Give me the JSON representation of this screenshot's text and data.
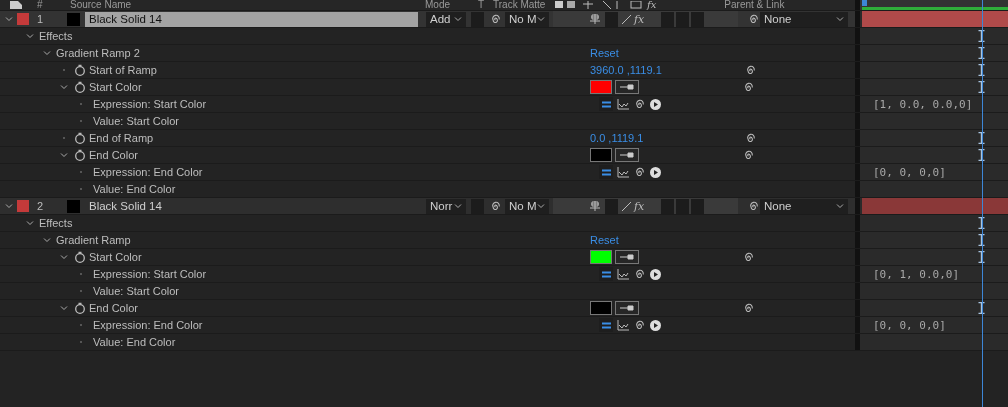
{
  "header": {
    "number": "#",
    "source_name": "Source Name",
    "mode": "Mode",
    "t": "T",
    "track_matte": "Track Matte",
    "fx": "fx",
    "parent_link": "Parent & Link"
  },
  "layers": [
    {
      "number": "1",
      "name": "Black Solid 14",
      "selected": true,
      "expanded": true,
      "color": "#c43a3a",
      "mode": "Add",
      "track_matte": "No M",
      "fx": "fx",
      "effects_on": true,
      "parent": "None",
      "children": [
        {
          "kind": "group",
          "label": "Effects",
          "expanded": true,
          "children": [
            {
              "kind": "effect",
              "label": "Gradient Ramp 2",
              "expanded": true,
              "reset": "Reset",
              "children": [
                {
                  "kind": "point",
                  "label": "Start of Ramp",
                  "value": "3960.0 ,1119.1"
                },
                {
                  "kind": "color",
                  "label": "Start Color",
                  "expanded": true,
                  "color": "#ff0000",
                  "children": [
                    {
                      "kind": "expression",
                      "label": "Expression: Start Color",
                      "result": "[1, 0.0, 0.0,0]"
                    },
                    {
                      "kind": "expression_value",
                      "label": "Value: Start Color"
                    }
                  ]
                },
                {
                  "kind": "point",
                  "label": "End of Ramp",
                  "value": "0.0 ,1119.1"
                },
                {
                  "kind": "color",
                  "label": "End Color",
                  "expanded": true,
                  "color": "#000000",
                  "children": [
                    {
                      "kind": "expression",
                      "label": "Expression: End Color",
                      "result": "[0, 0, 0,0]"
                    },
                    {
                      "kind": "expression_value",
                      "label": "Value: End Color"
                    }
                  ]
                }
              ]
            }
          ]
        }
      ]
    },
    {
      "number": "2",
      "name": "Black Solid 14",
      "selected": false,
      "expanded": true,
      "color": "#c43a3a",
      "mode": "Norr",
      "track_matte": "No M",
      "fx": "fx",
      "effects_on": true,
      "parent": "None",
      "children": [
        {
          "kind": "group",
          "label": "Effects",
          "expanded": true,
          "children": [
            {
              "kind": "effect",
              "label": "Gradient Ramp",
              "expanded": true,
              "reset": "Reset",
              "children": [
                {
                  "kind": "color",
                  "label": "Start Color",
                  "expanded": true,
                  "color": "#00ff00",
                  "children": [
                    {
                      "kind": "expression",
                      "label": "Expression: Start Color",
                      "result": "[0, 1, 0.0,0]"
                    },
                    {
                      "kind": "expression_value",
                      "label": "Value: Start Color"
                    }
                  ]
                },
                {
                  "kind": "color",
                  "label": "End Color",
                  "expanded": true,
                  "color": "#000000",
                  "children": [
                    {
                      "kind": "expression",
                      "label": "Expression: End Color",
                      "result": "[0, 0, 0,0]"
                    },
                    {
                      "kind": "expression_value",
                      "label": "Value: End Color"
                    }
                  ]
                }
              ]
            }
          ]
        }
      ]
    }
  ]
}
